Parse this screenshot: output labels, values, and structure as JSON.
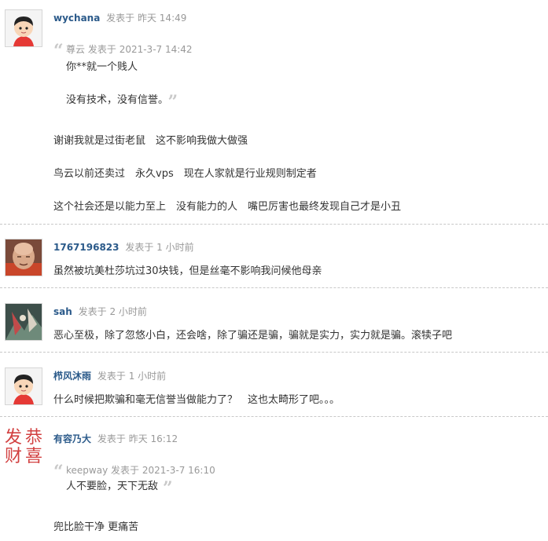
{
  "posts": [
    {
      "author": "wychana",
      "posted_label": "发表于",
      "time": "昨天 14:49",
      "quote": {
        "author": "尊云",
        "posted_label": "发表于",
        "time": "2021-3-7 14:42",
        "lines": [
          "你**就一个贱人",
          "没有技术，没有信誉。"
        ]
      },
      "lines": [
        "谢谢我就是过街老鼠　这不影响我做大做强",
        "鸟云以前还卖过　永久vps　现在人家就是行业规则制定者",
        "这个社会还是以能力至上　没有能力的人　嘴巴厉害也最终发现自己才是小丑"
      ]
    },
    {
      "author": "1767196823",
      "posted_label": "发表于",
      "time": "1 小时前",
      "lines": [
        "虽然被坑美杜莎坑过30块钱，但是丝毫不影响我问候他母亲"
      ]
    },
    {
      "author": "sah",
      "posted_label": "发表于",
      "time": "2 小时前",
      "lines": [
        "恶心至极，除了忽悠小白，还会啥，除了骗还是骗，骗就是实力，实力就是骗。滚犊子吧"
      ]
    },
    {
      "author": "栉风沐雨",
      "posted_label": "发表于",
      "time": "1 小时前",
      "lines": [
        "什么时候把欺骗和毫无信誉当做能力了？　这也太畸形了吧。。。"
      ]
    },
    {
      "author": "有容乃大",
      "posted_label": "发表于",
      "time": "昨天 16:12",
      "avatar_text": "发恭财喜",
      "quote": {
        "author": "keepway",
        "posted_label": "发表于",
        "time": "2021-3-7 16:10",
        "lines": [
          "人不要脸，天下无敌"
        ]
      },
      "lines": [
        "兜比脸干净 更痛苦"
      ]
    }
  ],
  "colors": {
    "author": "#2b5a8a",
    "meta": "#999999",
    "text": "#333333",
    "separator": "#c8c8c8",
    "stamp": "#d24040"
  }
}
